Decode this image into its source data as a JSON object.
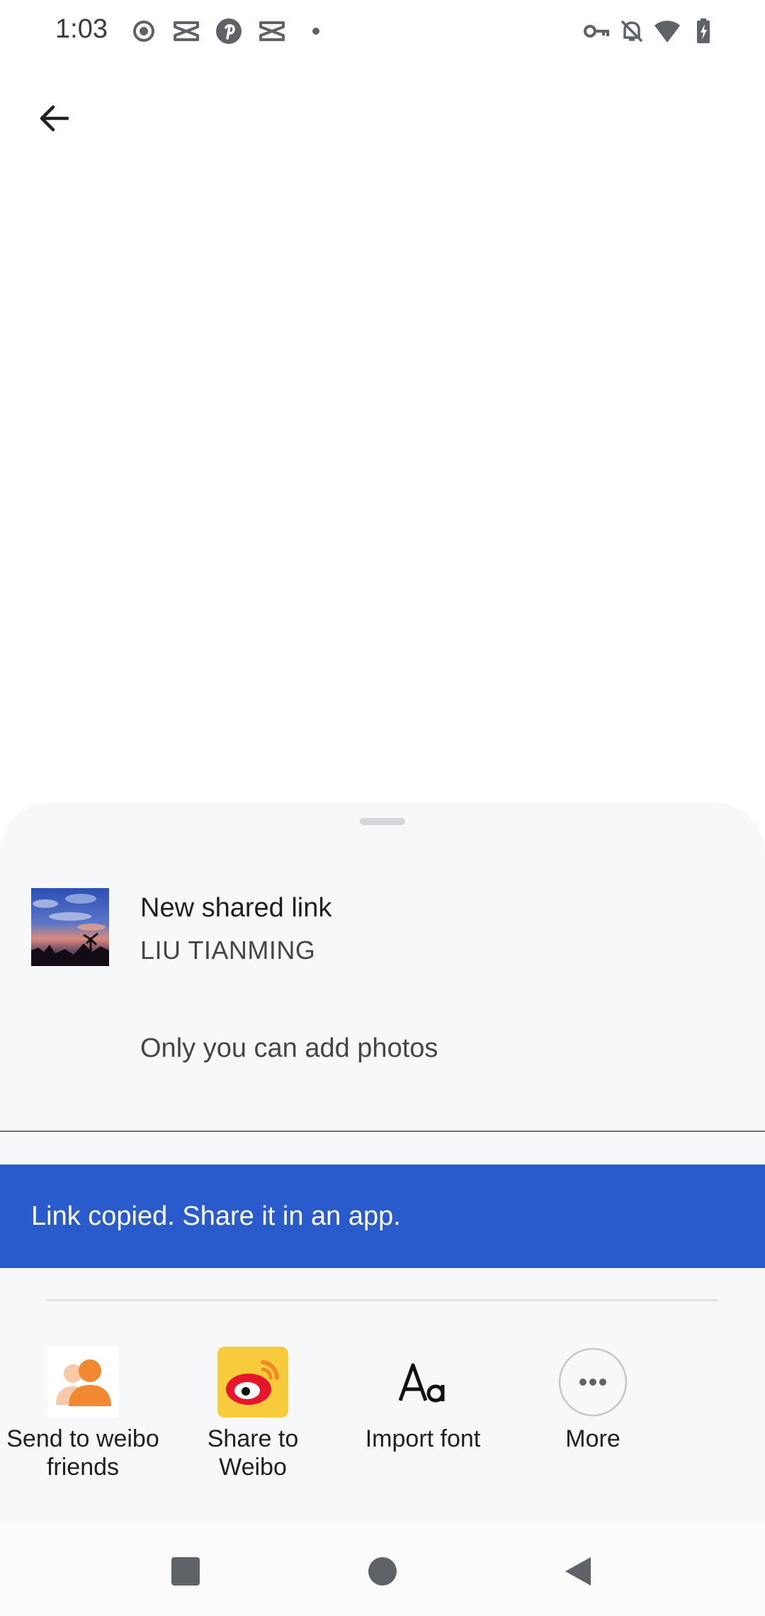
{
  "status_bar": {
    "time": "1:03",
    "left_icons": [
      "record-icon",
      "capcut-icon",
      "pinterest-icon",
      "capcut-icon",
      "dot-icon"
    ],
    "right_icons": [
      "vpn-key-icon",
      "bell-off-icon",
      "wifi-icon",
      "battery-charging-icon"
    ]
  },
  "header": {
    "back_icon": "arrow-left-icon"
  },
  "share_sheet": {
    "title": "New shared link",
    "owner": "LIU TIANMING",
    "note": "Only you can add photos",
    "toast": "Link copied. Share it in an app.",
    "apps": [
      {
        "label": "Send to weibo friends",
        "icon": "weibo-friends-icon"
      },
      {
        "label": "Share to Weibo",
        "icon": "weibo-icon"
      },
      {
        "label": "Import font",
        "icon": "font-aa-icon"
      },
      {
        "label": "More",
        "icon": "more-horiz-icon"
      }
    ]
  },
  "nav_bar": {
    "buttons": [
      "recents-button",
      "home-button",
      "back-button"
    ]
  },
  "colors": {
    "toast_bg": "#2a5bcc",
    "sheet_bg": "#f6f8fa",
    "weibo_orange": "#f0892f",
    "weibo_red": "#e6162d"
  }
}
